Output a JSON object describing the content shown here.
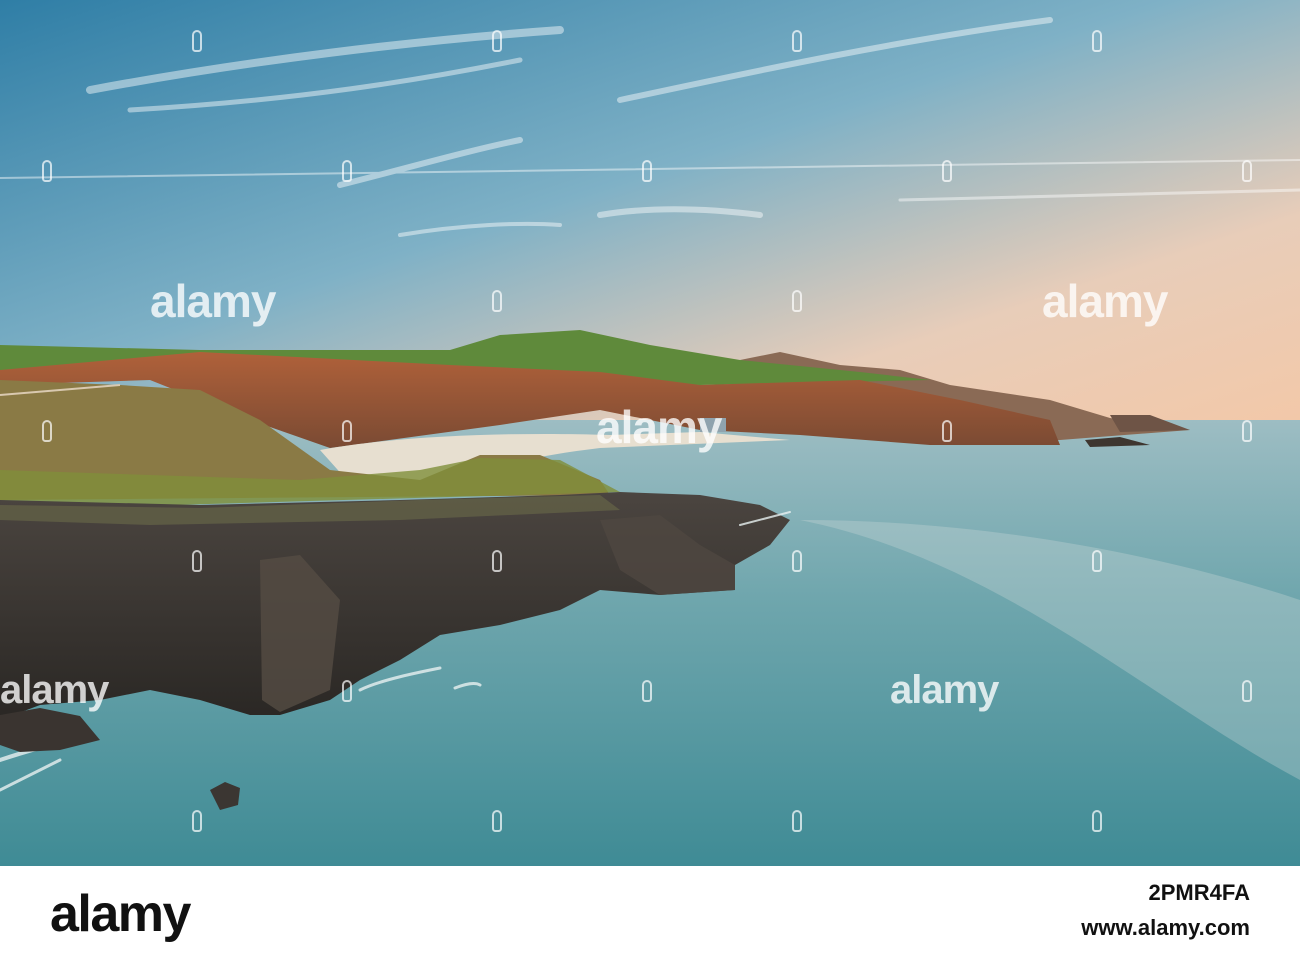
{
  "watermark": {
    "logo_text": "alamy"
  },
  "footer": {
    "logo_text": "alamy",
    "image_id": "2PMR4FA",
    "url": "www.alamy.com"
  },
  "colors": {
    "sky_top": "#3f86a8",
    "sky_warm": "#f1c9ad",
    "sea": "#5f9fa8",
    "cliff_dark": "#3a3530",
    "grass": "#6f8f3c",
    "beach": "#e6dccb"
  }
}
